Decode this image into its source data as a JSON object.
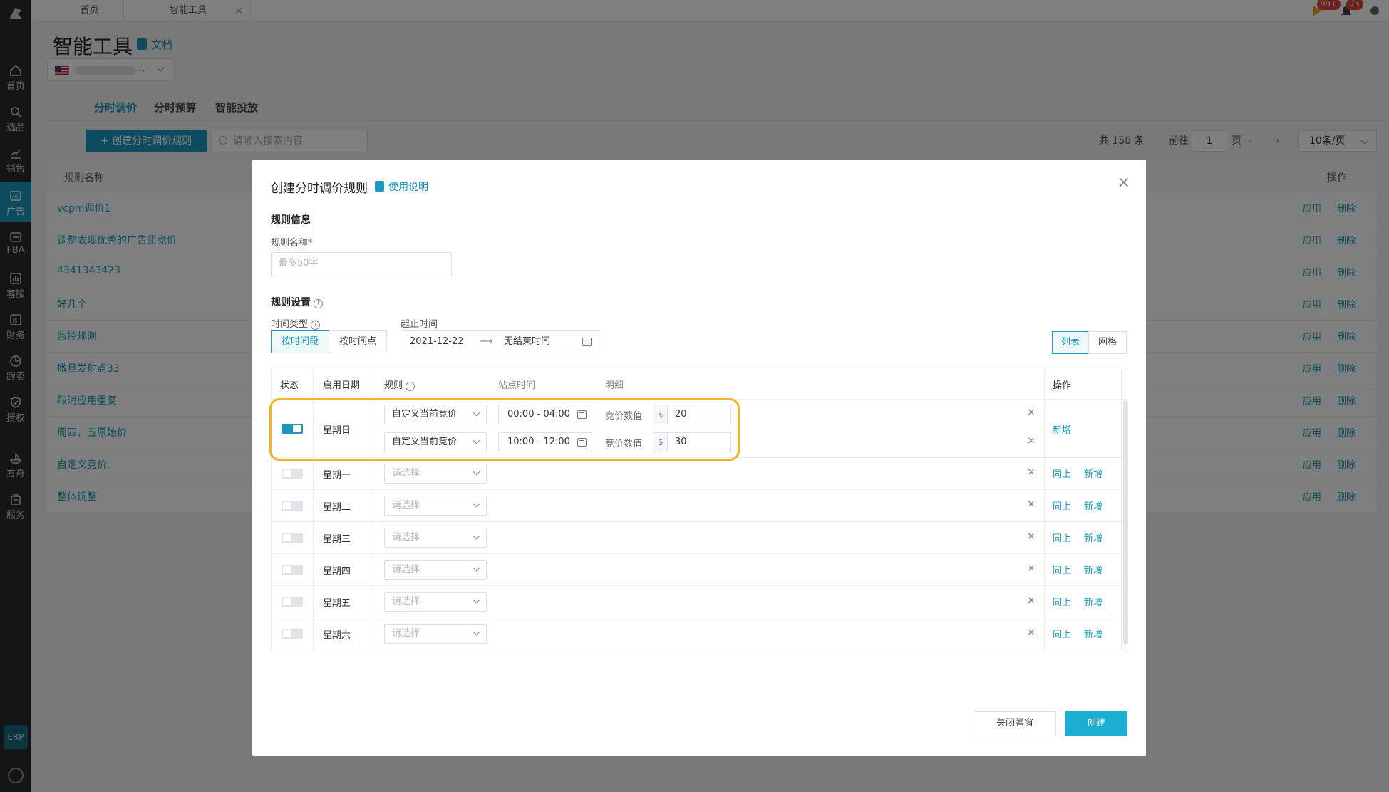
{
  "sidebar": {
    "items": [
      {
        "label": "首页",
        "icon": "home-icon"
      },
      {
        "label": "选品",
        "icon": "search-icon"
      },
      {
        "label": "销售",
        "icon": "chart-icon"
      },
      {
        "label": "广告",
        "icon": "ad-icon"
      },
      {
        "label": "FBA",
        "icon": "store-icon"
      },
      {
        "label": "客服",
        "icon": "bar-icon"
      },
      {
        "label": "财务",
        "icon": "dollar-icon"
      },
      {
        "label": "跟卖",
        "icon": "pie-icon"
      },
      {
        "label": "授权",
        "icon": "shield-icon"
      },
      {
        "label": "方舟",
        "icon": "ark-icon"
      },
      {
        "label": "服务",
        "icon": "service-icon"
      }
    ],
    "erp_label": "ERP",
    "active_index": 3
  },
  "topbar": {
    "tabs": [
      "首页",
      "智能工具"
    ],
    "close": "×",
    "flag_badge": "99+",
    "bell_badge": "75"
  },
  "page": {
    "title": "智能工具",
    "doc_link": "文档",
    "store_dots": "..",
    "subtabs": [
      "分时调价",
      "分时预算",
      "智能投放"
    ],
    "create_button": "+ 创建分时调价规则",
    "search_placeholder": "请输入搜索内容",
    "total": "共 158 条",
    "goto": "前往",
    "page_num": "1",
    "page_unit": "页",
    "page_size": "10条/页",
    "table": {
      "col_name": "规则名称",
      "col_actions": "操作",
      "apply": "应用",
      "delete": "删除",
      "rows": [
        "vcpm调价1",
        "调整表现优秀的广告组竞价",
        "4341343423",
        "好几个",
        "监控规则",
        "撒旦发射点33",
        "取消应用重复",
        "周四、五原始价",
        "自定义竞价.",
        "整体调整"
      ]
    }
  },
  "modal": {
    "title": "创建分时调价规则",
    "help": "使用说明",
    "close": "×",
    "section_info": "规则信息",
    "name_label": "规则名称",
    "required_mark": "*",
    "name_placeholder": "最多50字",
    "section_settings": "规则设置",
    "time_type_label": "时间类型",
    "time_type_options": [
      "按时间段",
      "按时间点"
    ],
    "date_label": "起止时间",
    "date_start": "2021-12-22",
    "date_arrow": "⟶",
    "date_end": "无结束时间",
    "view_options": [
      "列表",
      "网格"
    ],
    "info_glyph": "i",
    "grid": {
      "headers": {
        "status": "状态",
        "date": "启用日期",
        "rule": "规则",
        "site_time": "站点时间",
        "detail": "明细",
        "ops": "操作"
      },
      "sunday": {
        "day": "星期日",
        "enabled": true,
        "entries": [
          {
            "rule": "自定义当前竞价",
            "time": "00:00 - 04:00",
            "bid_label": "竞价数值",
            "currency": "$",
            "value": "20"
          },
          {
            "rule": "自定义当前竞价",
            "time": "10:00 - 12:00",
            "bid_label": "竞价数值",
            "currency": "$",
            "value": "30"
          }
        ],
        "op_add": "新增"
      },
      "rows": [
        {
          "day": "星期一",
          "placeholder": "请选择",
          "op_same": "同上",
          "op_add": "新增"
        },
        {
          "day": "星期二",
          "placeholder": "请选择",
          "op_same": "同上",
          "op_add": "新增"
        },
        {
          "day": "星期三",
          "placeholder": "请选择",
          "op_same": "同上",
          "op_add": "新增"
        },
        {
          "day": "星期四",
          "placeholder": "请选择",
          "op_same": "同上",
          "op_add": "新增"
        },
        {
          "day": "星期五",
          "placeholder": "请选择",
          "op_same": "同上",
          "op_add": "新增"
        },
        {
          "day": "星期六",
          "placeholder": "请选择",
          "op_same": "同上",
          "op_add": "新增"
        }
      ],
      "remove": "×"
    },
    "btn_close": "关闭弹窗",
    "btn_create": "创建"
  },
  "colors": {
    "accent": "#1b98bf",
    "highlight": "#f0b429",
    "sidebar": "#262b31"
  }
}
